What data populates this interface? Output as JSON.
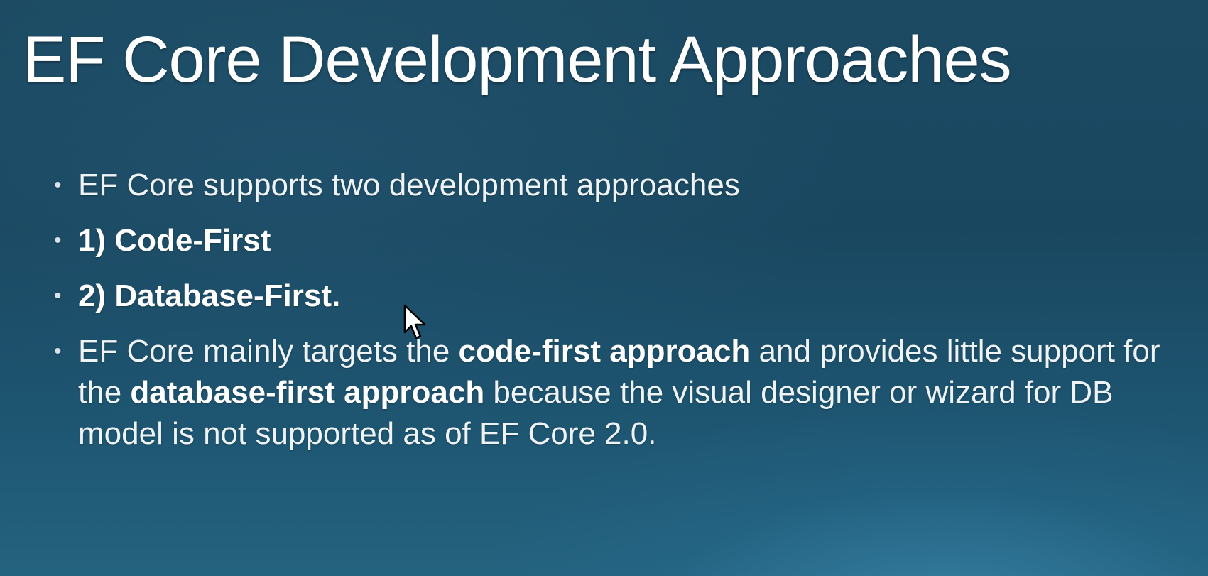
{
  "slide": {
    "title": "EF Core Development Approaches",
    "bullets": {
      "b1": "EF Core supports two development approaches",
      "b2": "1) Code-First",
      "b3": "2) Database-First.",
      "b4": {
        "part1": "EF Core mainly targets the ",
        "bold1": "code-first approach",
        "part2": " and provides little support for the ",
        "bold2": "database-first approach",
        "part3": " because the visual designer or wizard for DB model is not supported as of EF Core 2.0."
      }
    },
    "bullet_glyph": "•"
  },
  "colors": {
    "background_top": "#1c4a63",
    "background_bottom": "#24637f",
    "text": "#ffffff"
  },
  "icons": {
    "cursor": "mouse-pointer-icon"
  }
}
